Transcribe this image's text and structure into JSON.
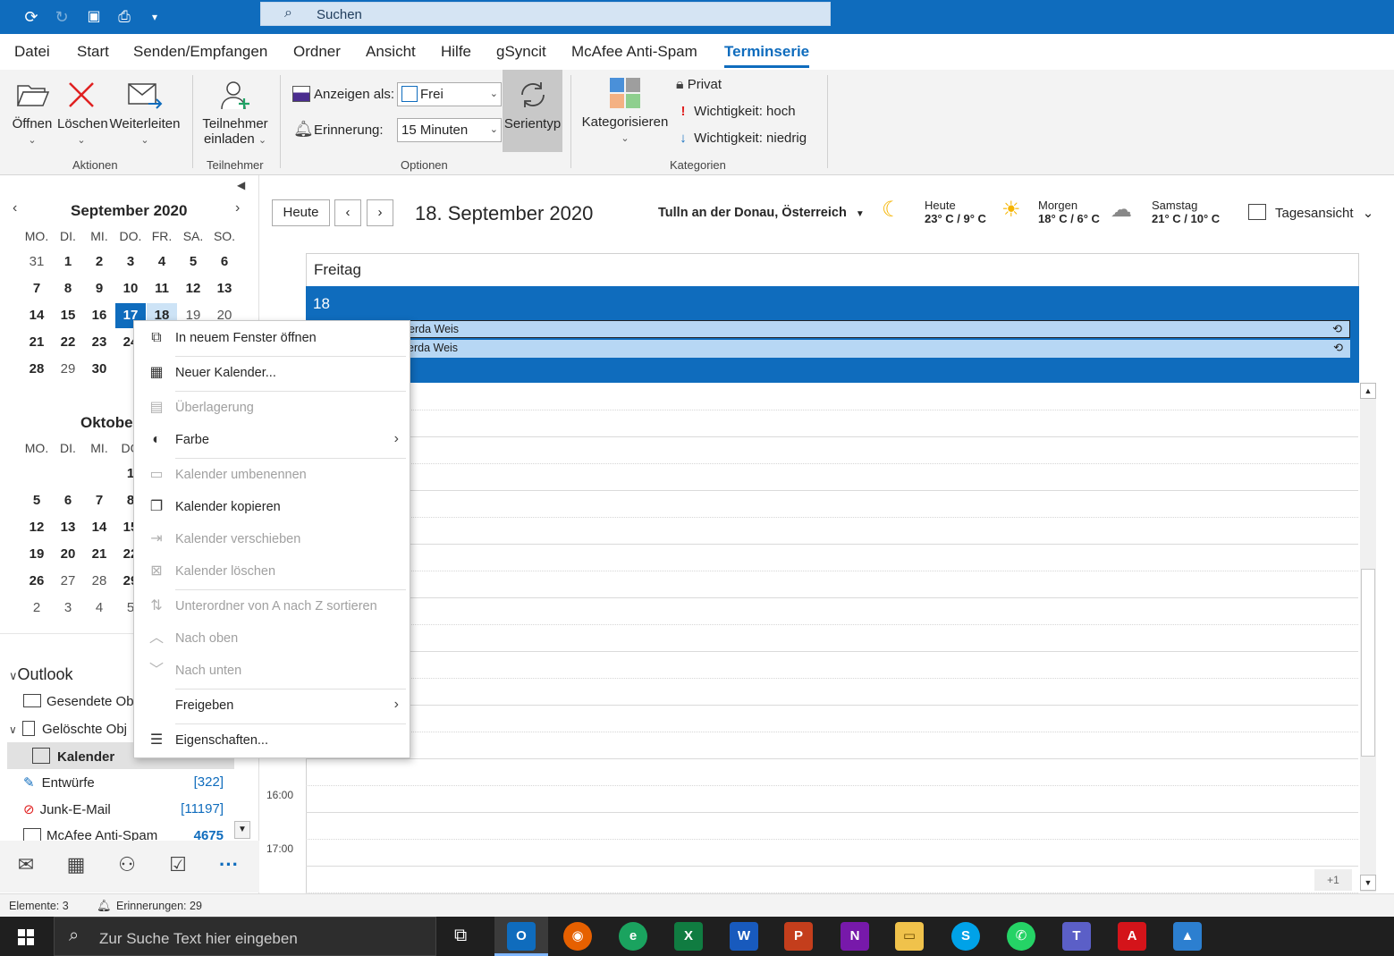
{
  "titlebar": {
    "search_placeholder": "Suchen",
    "icons": [
      "sync-icon",
      "redo-icon",
      "save-icon",
      "print-icon",
      "customize-icon"
    ]
  },
  "tabs": [
    "Datei",
    "Start",
    "Senden/Empfangen",
    "Ordner",
    "Ansicht",
    "Hilfe",
    "gSyncit",
    "McAfee Anti-Spam",
    "Terminserie"
  ],
  "ribbon": {
    "open": "Öffnen",
    "delete": "Löschen",
    "forward": "Weiterleiten",
    "group_actions": "Aktionen",
    "invite_line1": "Teilnehmer",
    "invite_line2": "einladen",
    "group_attendees": "Teilnehmer",
    "show_as_label": "Anzeigen als:",
    "show_as_value": "Frei",
    "reminder_label": "Erinnerung:",
    "reminder_value": "15 Minuten",
    "series_type": "Serientyp",
    "group_options": "Optionen",
    "categorize": "Kategorisieren",
    "private": "Privat",
    "importance_high": "Wichtigkeit: hoch",
    "importance_low": "Wichtigkeit: niedrig",
    "group_categories": "Kategorien"
  },
  "minical": {
    "sep_title": "September 2020",
    "oct_title": "Oktobe",
    "dow": [
      "MO.",
      "DI.",
      "MI.",
      "DO.",
      "FR.",
      "SA.",
      "SO."
    ],
    "dow_oct": [
      "MO.",
      "DI.",
      "MI.",
      "DO"
    ],
    "sep_rows": [
      [
        "31",
        "1",
        "2",
        "3",
        "4",
        "5",
        "6"
      ],
      [
        "7",
        "8",
        "9",
        "10",
        "11",
        "12",
        "13"
      ],
      [
        "14",
        "15",
        "16",
        "17",
        "18",
        "19",
        "20"
      ],
      [
        "21",
        "22",
        "23",
        "24"
      ],
      [
        "28",
        "29",
        "30"
      ]
    ],
    "oct_rows": [
      [
        "",
        "",
        "",
        "1"
      ],
      [
        "5",
        "6",
        "7",
        "8"
      ],
      [
        "12",
        "13",
        "14",
        "15"
      ],
      [
        "19",
        "20",
        "21",
        "22"
      ],
      [
        "26",
        "27",
        "28",
        "29"
      ],
      [
        "2",
        "3",
        "4",
        "5"
      ]
    ]
  },
  "folders": {
    "root": "Outlook",
    "items": [
      {
        "label": "Gesendete Obj",
        "count": ""
      },
      {
        "label": "Gelöschte Obj",
        "count": ""
      },
      {
        "label": "Kalender",
        "count": ""
      },
      {
        "label": "Entwürfe",
        "count": "[322]"
      },
      {
        "label": "Junk-E-Mail",
        "count": "[11197]"
      },
      {
        "label": "McAfee Anti-Spam",
        "count": "4675"
      }
    ]
  },
  "calendar": {
    "today_btn": "Heute",
    "date_title": "18. September 2020",
    "location": "Tulln an der Donau, Österreich",
    "weather": [
      {
        "label": "Heute",
        "temp": "23° C / 9° C",
        "icon": "partly-cloudy-moon-icon"
      },
      {
        "label": "Morgen",
        "temp": "18° C / 6° C",
        "icon": "sun-icon"
      },
      {
        "label": "Samstag",
        "temp": "21° C / 10° C",
        "icon": "partly-cloudy-icon"
      }
    ],
    "view": "Tagesansicht",
    "day_name": "Freitag",
    "day_num": "18",
    "events": [
      "erda Weis",
      "erda Weis"
    ],
    "hours": [
      "16:00",
      "17:00"
    ],
    "more": "+1"
  },
  "context_menu": [
    {
      "label": "In neuem Fenster öffnen",
      "enabled": true,
      "icon": "new-window-icon"
    },
    {
      "label": "Neuer Kalender...",
      "enabled": true,
      "icon": "calendar-icon"
    },
    {
      "label": "Überlagerung",
      "enabled": false,
      "icon": "overlay-icon"
    },
    {
      "label": "Farbe",
      "enabled": true,
      "icon": "color-palette-icon",
      "submenu": true
    },
    {
      "label": "Kalender umbenennen",
      "enabled": false,
      "icon": "rename-icon"
    },
    {
      "label": "Kalender kopieren",
      "enabled": true,
      "icon": "copy-icon"
    },
    {
      "label": "Kalender verschieben",
      "enabled": false,
      "icon": "move-icon"
    },
    {
      "label": "Kalender löschen",
      "enabled": false,
      "icon": "delete-calendar-icon"
    },
    {
      "label": "Unterordner von A nach Z sortieren",
      "enabled": false,
      "icon": "sort-az-icon"
    },
    {
      "label": "Nach oben",
      "enabled": false,
      "icon": "chevron-up-icon"
    },
    {
      "label": "Nach unten",
      "enabled": false,
      "icon": "chevron-down-icon"
    },
    {
      "label": "Freigeben",
      "enabled": true,
      "icon": "",
      "submenu": true
    },
    {
      "label": "Eigenschaften...",
      "enabled": true,
      "icon": "properties-icon"
    }
  ],
  "status": {
    "items": "Elemente: 3",
    "reminders": "Erinnerungen: 29"
  },
  "taskbar": {
    "search_placeholder": "Zur Suche Text hier eingeben"
  }
}
